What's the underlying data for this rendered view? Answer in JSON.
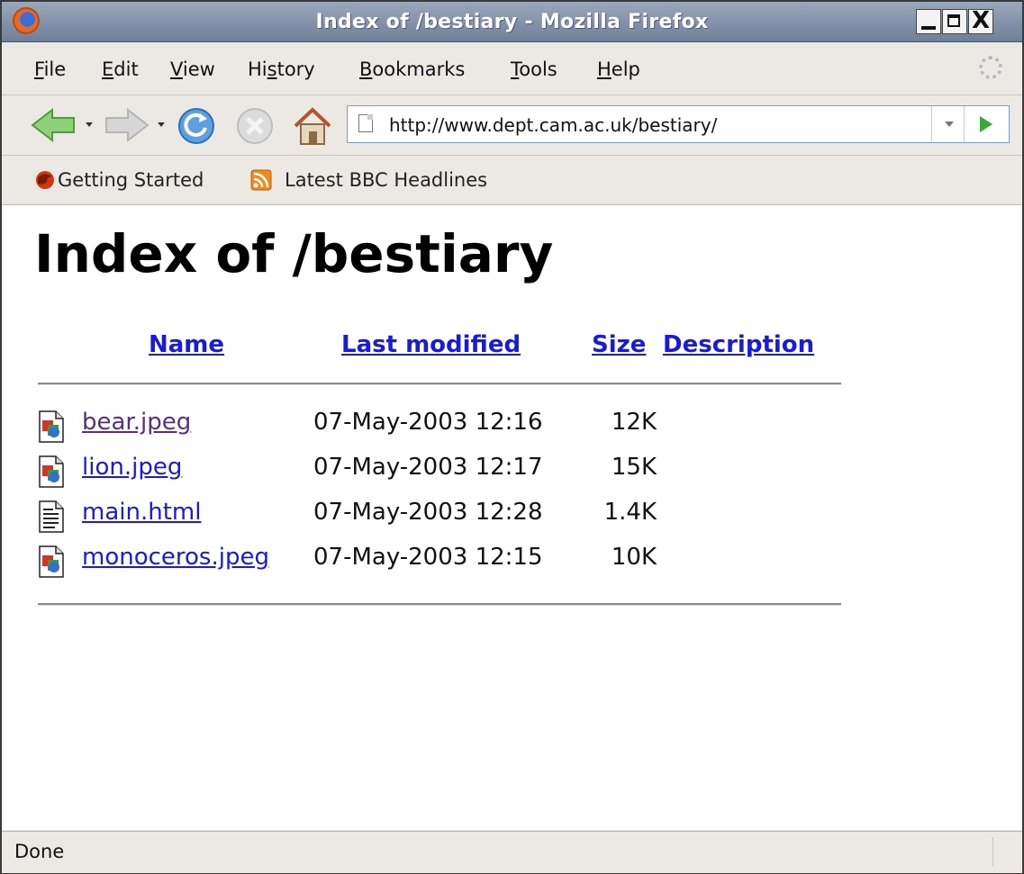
{
  "window": {
    "title": "Index of /bestiary - Mozilla Firefox",
    "close_glyph": "X"
  },
  "menu": {
    "items": [
      {
        "accel": "F",
        "rest": "ile"
      },
      {
        "accel": "E",
        "rest": "dit"
      },
      {
        "accel": "V",
        "rest": "iew"
      },
      {
        "pre": "Hi",
        "accel": "s",
        "rest": "tory"
      },
      {
        "accel": "B",
        "rest": "ookmarks"
      },
      {
        "accel": "T",
        "rest": "ools"
      },
      {
        "accel": "H",
        "rest": "elp"
      }
    ]
  },
  "navigation": {
    "url": "http://www.dept.cam.ac.uk/bestiary/",
    "icons": [
      "back-icon",
      "forward-icon",
      "reload-icon",
      "stop-icon",
      "home-icon",
      "go-icon"
    ]
  },
  "bookmarks": {
    "items": [
      {
        "label": "Getting Started",
        "icon": "firefox-bookmark-icon"
      },
      {
        "label": "Latest BBC Headlines",
        "icon": "rss-feed-icon"
      }
    ]
  },
  "page": {
    "title": "Index of /bestiary",
    "columns": {
      "name": "Name",
      "last_modified": "Last modified",
      "size": "Size",
      "description": "Description"
    },
    "files": [
      {
        "name": "bear.jpeg",
        "modified": "07-May-2003 12:16",
        "size": "12K",
        "type": "image",
        "visited": true
      },
      {
        "name": "lion.jpeg",
        "modified": "07-May-2003 12:17",
        "size": "15K",
        "type": "image",
        "visited": false
      },
      {
        "name": "main.html",
        "modified": "07-May-2003 12:28",
        "size": "1.4K",
        "type": "text",
        "visited": false
      },
      {
        "name": "monoceros.jpeg",
        "modified": "07-May-2003 12:15",
        "size": "10K",
        "type": "image",
        "visited": false
      }
    ]
  },
  "status": {
    "text": "Done"
  },
  "colors": {
    "link": "#1a1adb",
    "visited_link": "#5b2d86",
    "titlebar": "#7f8ea8"
  }
}
